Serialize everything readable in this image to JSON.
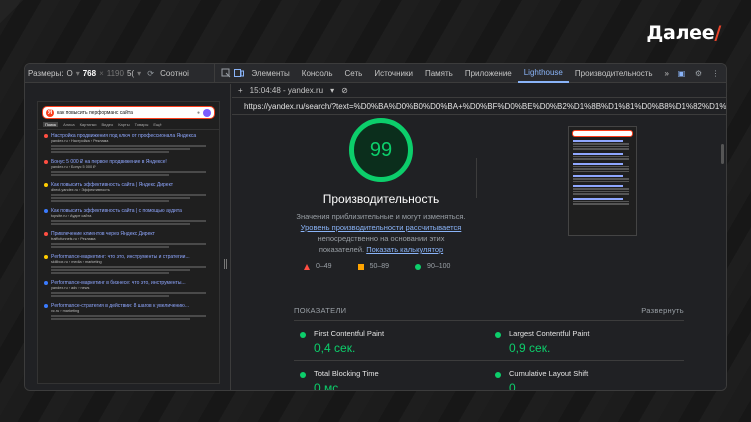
{
  "brand": {
    "name": "Далее",
    "slash": "/"
  },
  "device_toolbar": {
    "sizes_label": "Размеры:",
    "preset_short": "О",
    "width": "768",
    "times": "×",
    "height": "1190",
    "zoom": "5(",
    "ratio_label": "Соотноі"
  },
  "devtools": {
    "tabs": [
      "Элементы",
      "Консоль",
      "Сеть",
      "Источники",
      "Память",
      "Приложение",
      "Lighthouse",
      "Производительность"
    ],
    "active_tab": "Lighthouse",
    "more": "»",
    "badge": "1"
  },
  "lighthouse": {
    "time_host": "15:04:48 - yandex.ru",
    "url": "https://yandex.ru/search/?text=%D0%BA%D0%B0%D0%BA+%D0%BF%D0%BE%D0%B2%D1%8B%D1%81%D0%B8%D1%82%D1%8C+%D0%BF%D0%B5%D1%80%D1%84...",
    "score": "99",
    "category": "Производительность",
    "desc_1": "Значения приблизительные и могут изменяться.",
    "desc_link": "Уровень производительности рассчитывается",
    "desc_2": "непосредственно на основании этих",
    "desc_3": "показателей.",
    "calc_link": "Показать калькулятор",
    "legend": [
      {
        "label": "0–49",
        "color": "#ff4e42"
      },
      {
        "label": "50–89",
        "color": "#ffa400"
      },
      {
        "label": "90–100",
        "color": "#0cce6b"
      }
    ],
    "metrics_header": "ПОКАЗАТЕЛИ",
    "expand": "Развернуть",
    "metrics": [
      {
        "name": "First Contentful Paint",
        "value": "0,4 сек."
      },
      {
        "name": "Largest Contentful Paint",
        "value": "0,9 сек."
      },
      {
        "name": "Total Blocking Time",
        "value": "0 мс"
      },
      {
        "name": "Cumulative Layout Shift",
        "value": "0"
      }
    ]
  },
  "phone": {
    "query": "как повысить перформанс сайта",
    "tabs": [
      "Поиск",
      "Алиса",
      "Картинки",
      "Видео",
      "Карты",
      "Товары",
      "Ещё"
    ],
    "results": [
      {
        "title": "Настройка продвижения под ключ от профессионала Яндекса",
        "url": "yandex.ru › Настройка › Реклама",
        "dot": "#ff4e42"
      },
      {
        "title": "Бонус 5 000 ₽ на первое продвижение в Яндексе!",
        "url": "yandex.ru › Бонус 5 000 ₽",
        "dot": "#ff4e42"
      },
      {
        "title": "Как повысить эффективность сайта | Яндекс Директ",
        "url": "direct.yandex.ru › Эффективность",
        "dot": "#ffcc00"
      },
      {
        "title": "Как повысить эффективность сайта | с помощью аудита",
        "url": "topsite.ru › Аудит сайта",
        "dot": "#3a7bff"
      },
      {
        "title": "Привлечение клиентов через Яндекс Директ",
        "url": "trafficfunnels.ru › Реклама",
        "dot": "#ff4e42"
      },
      {
        "title": "Performance-маркетинг: что это, инструменты и стратегии...",
        "url": "skillbox.ru › media › marketing",
        "dot": "#ffcc00"
      },
      {
        "title": "Performance-маркетинг в бизнесе: что это, инструменты...",
        "url": "yandex.ru › adv › news",
        "dot": "#3a7bff"
      },
      {
        "title": "Performance-стратегия в действии: 8 шагов к увеличению...",
        "url": "vc.ru › marketing",
        "dot": "#3a7bff"
      }
    ]
  }
}
